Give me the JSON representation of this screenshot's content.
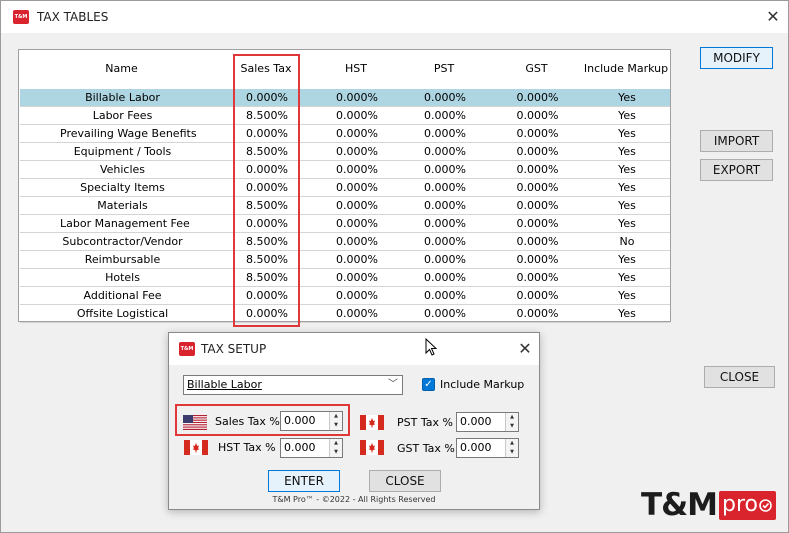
{
  "window": {
    "title": "TAX TABLES",
    "logo_text": "T&M",
    "close_glyph": "✕"
  },
  "table": {
    "columns": [
      "Name",
      "Sales Tax",
      "HST",
      "PST",
      "GST",
      "Include Markup"
    ],
    "rows": [
      [
        "Billable Labor",
        "0.000%",
        "0.000%",
        "0.000%",
        "0.000%",
        "Yes"
      ],
      [
        "Labor Fees",
        "8.500%",
        "0.000%",
        "0.000%",
        "0.000%",
        "Yes"
      ],
      [
        "Prevailing Wage Benefits",
        "0.000%",
        "0.000%",
        "0.000%",
        "0.000%",
        "Yes"
      ],
      [
        "Equipment / Tools",
        "8.500%",
        "0.000%",
        "0.000%",
        "0.000%",
        "Yes"
      ],
      [
        "Vehicles",
        "0.000%",
        "0.000%",
        "0.000%",
        "0.000%",
        "Yes"
      ],
      [
        "Specialty Items",
        "0.000%",
        "0.000%",
        "0.000%",
        "0.000%",
        "Yes"
      ],
      [
        "Materials",
        "8.500%",
        "0.000%",
        "0.000%",
        "0.000%",
        "Yes"
      ],
      [
        "Labor Management Fee",
        "0.000%",
        "0.000%",
        "0.000%",
        "0.000%",
        "Yes"
      ],
      [
        "Subcontractor/Vendor",
        "8.500%",
        "0.000%",
        "0.000%",
        "0.000%",
        "No"
      ],
      [
        "Reimbursable",
        "8.500%",
        "0.000%",
        "0.000%",
        "0.000%",
        "Yes"
      ],
      [
        "Hotels",
        "8.500%",
        "0.000%",
        "0.000%",
        "0.000%",
        "Yes"
      ],
      [
        "Additional Fee",
        "0.000%",
        "0.000%",
        "0.000%",
        "0.000%",
        "Yes"
      ],
      [
        "Offsite Logistical",
        "0.000%",
        "0.000%",
        "0.000%",
        "0.000%",
        "Yes"
      ]
    ],
    "selected_row": 0
  },
  "buttons": {
    "modify": "MODIFY",
    "import": "IMPORT",
    "export": "EXPORT",
    "close": "CLOSE"
  },
  "dialog": {
    "title": "TAX SETUP",
    "logo_text": "T&M",
    "close_glyph": "✕",
    "category_value": "Billable Labor",
    "include_markup_label": "Include Markup",
    "include_markup_checked": true,
    "sales_tax_label": "Sales Tax %",
    "sales_tax_value": "0.000",
    "hst_label": "HST Tax %",
    "hst_value": "0.000",
    "pst_label": "PST Tax %",
    "pst_value": "0.000",
    "gst_label": "GST Tax %",
    "gst_value": "0.000",
    "enter_label": "ENTER",
    "close_label": "CLOSE",
    "copyright": "T&M Pro™ - ©2022 - All Rights Reserved"
  },
  "brand": {
    "logo_main": "T&M",
    "logo_suffix": "pro",
    "accent": "#d9232d"
  },
  "icons": {
    "us_flag": "us-flag-icon",
    "ca_flag": "canada-flag-icon"
  }
}
